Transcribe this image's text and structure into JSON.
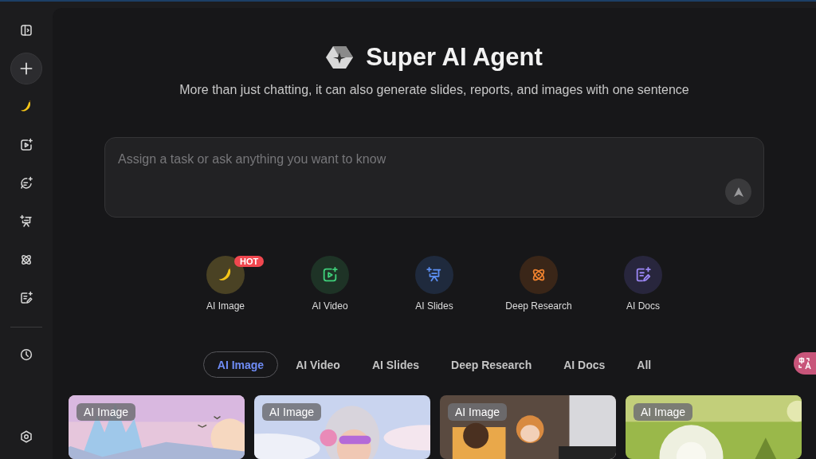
{
  "header": {
    "title": "Super AI Agent",
    "subtitle": "More than just chatting, it can also generate slides, reports, and images with one sentence"
  },
  "prompt": {
    "placeholder": "Assign a task or ask anything you want to know"
  },
  "features": [
    {
      "label": "AI Image",
      "color": "#4a4224",
      "badge": "HOT"
    },
    {
      "label": "AI Video",
      "color": "#1e3326"
    },
    {
      "label": "AI Slides",
      "color": "#1f2a3d"
    },
    {
      "label": "Deep Research",
      "color": "#3a2618"
    },
    {
      "label": "AI Docs",
      "color": "#28263d"
    }
  ],
  "tabs": [
    {
      "label": "AI Image",
      "selected": true
    },
    {
      "label": "AI Video",
      "selected": false
    },
    {
      "label": "AI Slides",
      "selected": false
    },
    {
      "label": "Deep Research",
      "selected": false
    },
    {
      "label": "AI Docs",
      "selected": false
    },
    {
      "label": "All",
      "selected": false
    }
  ],
  "gallery": [
    {
      "badge": "AI Image"
    },
    {
      "badge": "AI Image"
    },
    {
      "badge": "AI Image"
    },
    {
      "badge": "AI Image"
    }
  ]
}
